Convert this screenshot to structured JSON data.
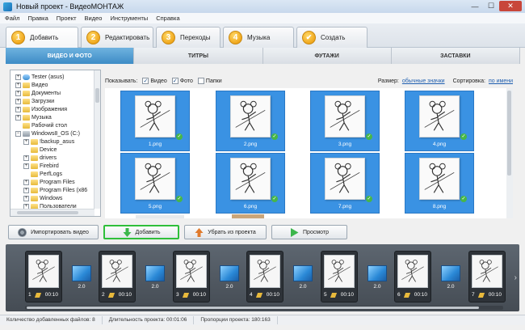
{
  "window": {
    "title": "Новый проект - ВидеоМОНТАЖ"
  },
  "menu": [
    "Файл",
    "Правка",
    "Проект",
    "Видео",
    "Инструменты",
    "Справка"
  ],
  "steps": [
    {
      "num": "1",
      "label": "Добавить"
    },
    {
      "num": "2",
      "label": "Редактировать"
    },
    {
      "num": "3",
      "label": "Переходы"
    },
    {
      "num": "4",
      "label": "Музыка"
    },
    {
      "num": "✔",
      "label": "Создать"
    }
  ],
  "category_tabs": [
    "ВИДЕО И ФОТО",
    "ТИТРЫ",
    "ФУТАЖИ",
    "ЗАСТАВКИ"
  ],
  "tree": [
    {
      "label": "Tester (asus)",
      "exp": "+",
      "icon": "user",
      "indent": 0
    },
    {
      "label": "Видео",
      "exp": "+",
      "icon": "folder",
      "indent": 0
    },
    {
      "label": "Документы",
      "exp": "+",
      "icon": "folder",
      "indent": 0
    },
    {
      "label": "Загрузки",
      "exp": "+",
      "icon": "folder",
      "indent": 0
    },
    {
      "label": "Изображения",
      "exp": "+",
      "icon": "folder",
      "indent": 0
    },
    {
      "label": "Музыка",
      "exp": "+",
      "icon": "folder",
      "indent": 0
    },
    {
      "label": "Рабочий стол",
      "exp": "",
      "icon": "folder",
      "indent": 0
    },
    {
      "label": "Windows8_OS (C:)",
      "exp": "−",
      "icon": "drive",
      "indent": 0
    },
    {
      "label": "!backup_asus",
      "exp": "+",
      "icon": "folder",
      "indent": 1
    },
    {
      "label": "Device",
      "exp": "",
      "icon": "folder",
      "indent": 1
    },
    {
      "label": "drivers",
      "exp": "+",
      "icon": "folder",
      "indent": 1
    },
    {
      "label": "Firebird",
      "exp": "+",
      "icon": "folder",
      "indent": 1
    },
    {
      "label": "PerfLogs",
      "exp": "",
      "icon": "folder",
      "indent": 1
    },
    {
      "label": "Program Files",
      "exp": "+",
      "icon": "folder",
      "indent": 1
    },
    {
      "label": "Program Files (x86",
      "exp": "+",
      "icon": "folder",
      "indent": 1
    },
    {
      "label": "Windows",
      "exp": "+",
      "icon": "folder",
      "indent": 1
    },
    {
      "label": "Пользователи",
      "exp": "+",
      "icon": "folder",
      "indent": 1
    }
  ],
  "options": {
    "show_label": "Показывать:",
    "video": {
      "label": "Видео",
      "checked": true
    },
    "photo": {
      "label": "Фото",
      "checked": true
    },
    "folders": {
      "label": "Папки",
      "checked": false
    },
    "size_label": "Размер:",
    "size_value": "обычные значки",
    "sort_label": "Сортировка:",
    "sort_value": "по имени"
  },
  "files": [
    "1.png",
    "2.png",
    "3.png",
    "4.png",
    "5.png",
    "6.png",
    "7.png",
    "8.png"
  ],
  "actions": {
    "import": "Импортировать видео",
    "add": "Добавить",
    "remove": "Убрать из проекта",
    "preview": "Просмотр"
  },
  "timeline": {
    "clips": [
      {
        "num": "1",
        "dur": "00:10"
      },
      {
        "num": "2",
        "dur": "00:10"
      },
      {
        "num": "3",
        "dur": "00:10"
      },
      {
        "num": "4",
        "dur": "00:10"
      },
      {
        "num": "5",
        "dur": "00:10"
      },
      {
        "num": "6",
        "dur": "00:10"
      },
      {
        "num": "7",
        "dur": "00:10"
      }
    ],
    "transitions": [
      "2.0",
      "2.0",
      "2.0",
      "2.0",
      "2.0",
      "2.0"
    ]
  },
  "status": {
    "files_added": "Количество добавленных файлов: 8",
    "duration": "Длительность проекта: 00:01:06",
    "aspect": "Пропорции проекта: 180:163"
  }
}
